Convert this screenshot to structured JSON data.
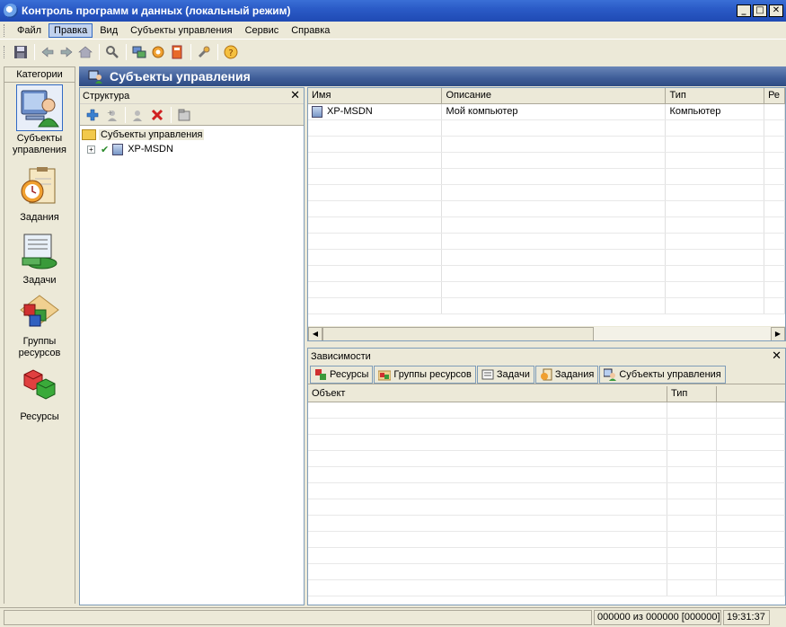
{
  "window": {
    "title": "Контроль программ и данных (локальный режим)",
    "btn_min": "_",
    "btn_max": "□",
    "btn_close": "✕"
  },
  "menu": [
    "Файл",
    "Правка",
    "Вид",
    "Субъекты управления",
    "Сервис",
    "Справка"
  ],
  "categories": {
    "header": "Категории",
    "items": [
      "Субъекты управления",
      "Задания",
      "Задачи",
      "Группы ресурсов",
      "Ресурсы"
    ]
  },
  "main": {
    "title": "Субъекты управления"
  },
  "structure": {
    "title": "Структура",
    "close": "✕",
    "root_label": "Субъекты управления",
    "child_label": "XP-MSDN",
    "expander": "+",
    "check": "✔"
  },
  "list": {
    "columns": [
      "Имя",
      "Описание",
      "Тип",
      "Ре"
    ],
    "rows": [
      {
        "name": "XP-MSDN",
        "description": "Мой компьютер",
        "type": "Компьютер",
        "extra": ""
      }
    ]
  },
  "dependencies": {
    "title": "Зависимости",
    "close": "✕",
    "tabs": [
      "Ресурсы",
      "Группы ресурсов",
      "Задачи",
      "Задания",
      "Субъекты управления"
    ],
    "columns": [
      "Объект",
      "Тип"
    ]
  },
  "status": {
    "count": "000000 из 000000 [000000]",
    "time": "19:31:37"
  },
  "colors": {
    "title_bar": "#2b5bc7",
    "header_bar": "#3e5d98",
    "selection": "#316ac5"
  }
}
